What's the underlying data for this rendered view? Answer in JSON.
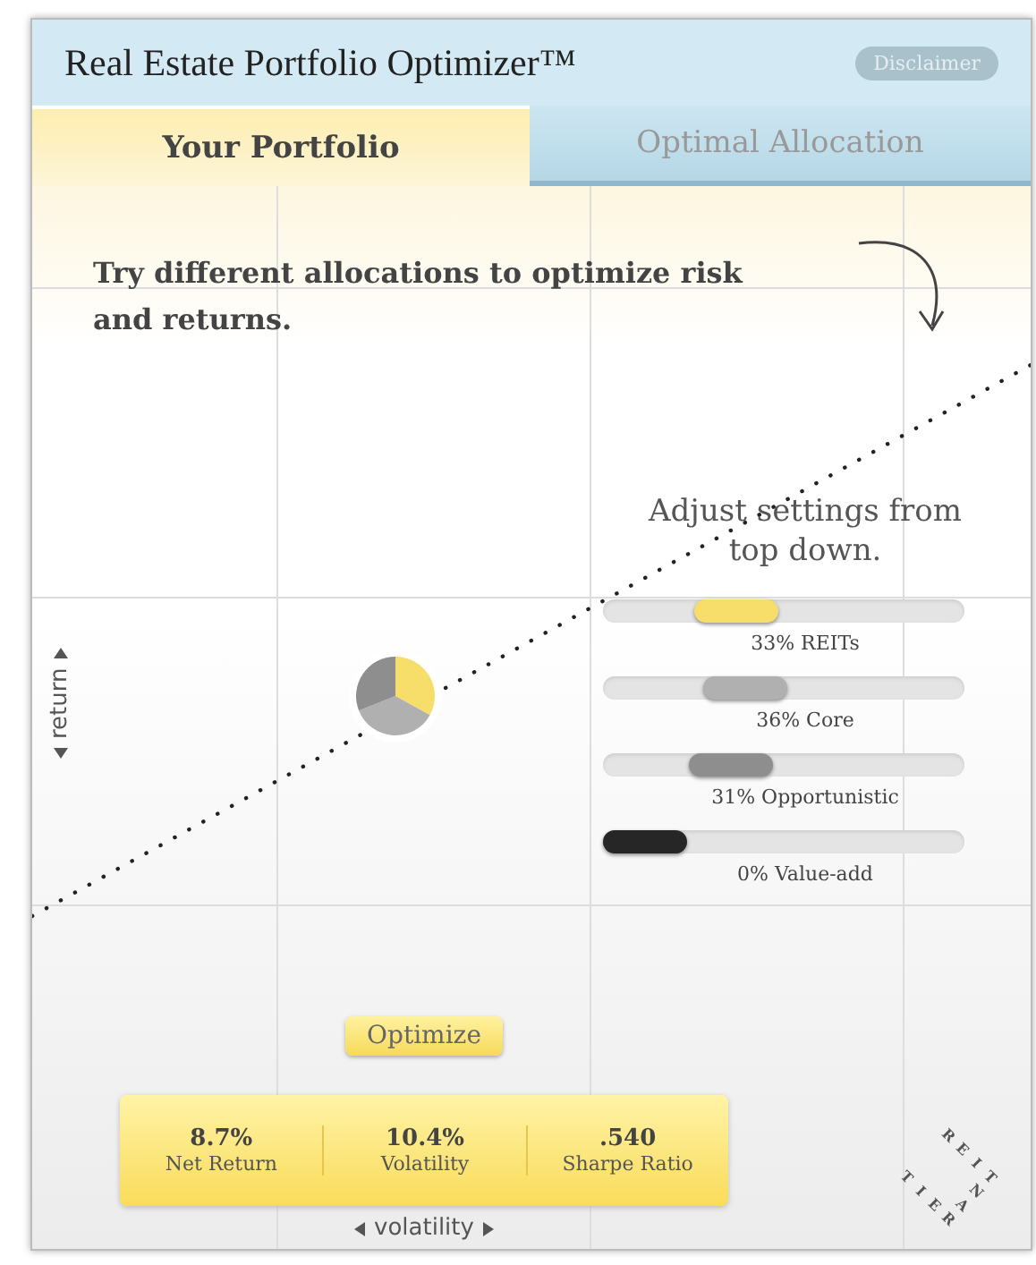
{
  "window": {
    "title": "Real Estate Portfolio Optimizer™",
    "disclaimer": "Disclaimer"
  },
  "tabs": [
    {
      "label": "Your Portfolio",
      "selected": true
    },
    {
      "label": "Optimal Allocation",
      "selected": false
    }
  ],
  "instruction": "Try different allocations to optimize risk and returns.",
  "hint": "Adjust settings from top down.",
  "sliders": [
    {
      "label": "33% REITs",
      "level": 0.33,
      "color": "#f7de6a"
    },
    {
      "label": "36% Core",
      "level": 0.36,
      "color": "#b0b0b0"
    },
    {
      "label": "31% Opportunistic",
      "level": 0.31,
      "color": "#8e8e8e"
    },
    {
      "label": "0% Value-add",
      "level": 0,
      "color": "#262626"
    }
  ],
  "axes": {
    "y": "return",
    "x": "volatility"
  },
  "optimize_button": "Optimize",
  "stats": [
    {
      "value": "8.7%",
      "label": "Net Return"
    },
    {
      "value": "10.4%",
      "label": "Volatility"
    },
    {
      "value": ".540",
      "label": "Sharpe Ratio"
    }
  ],
  "logo": {
    "letters": [
      "R",
      "E",
      "I",
      "T",
      "N",
      "A",
      "R",
      "E",
      "I",
      "T"
    ]
  }
}
